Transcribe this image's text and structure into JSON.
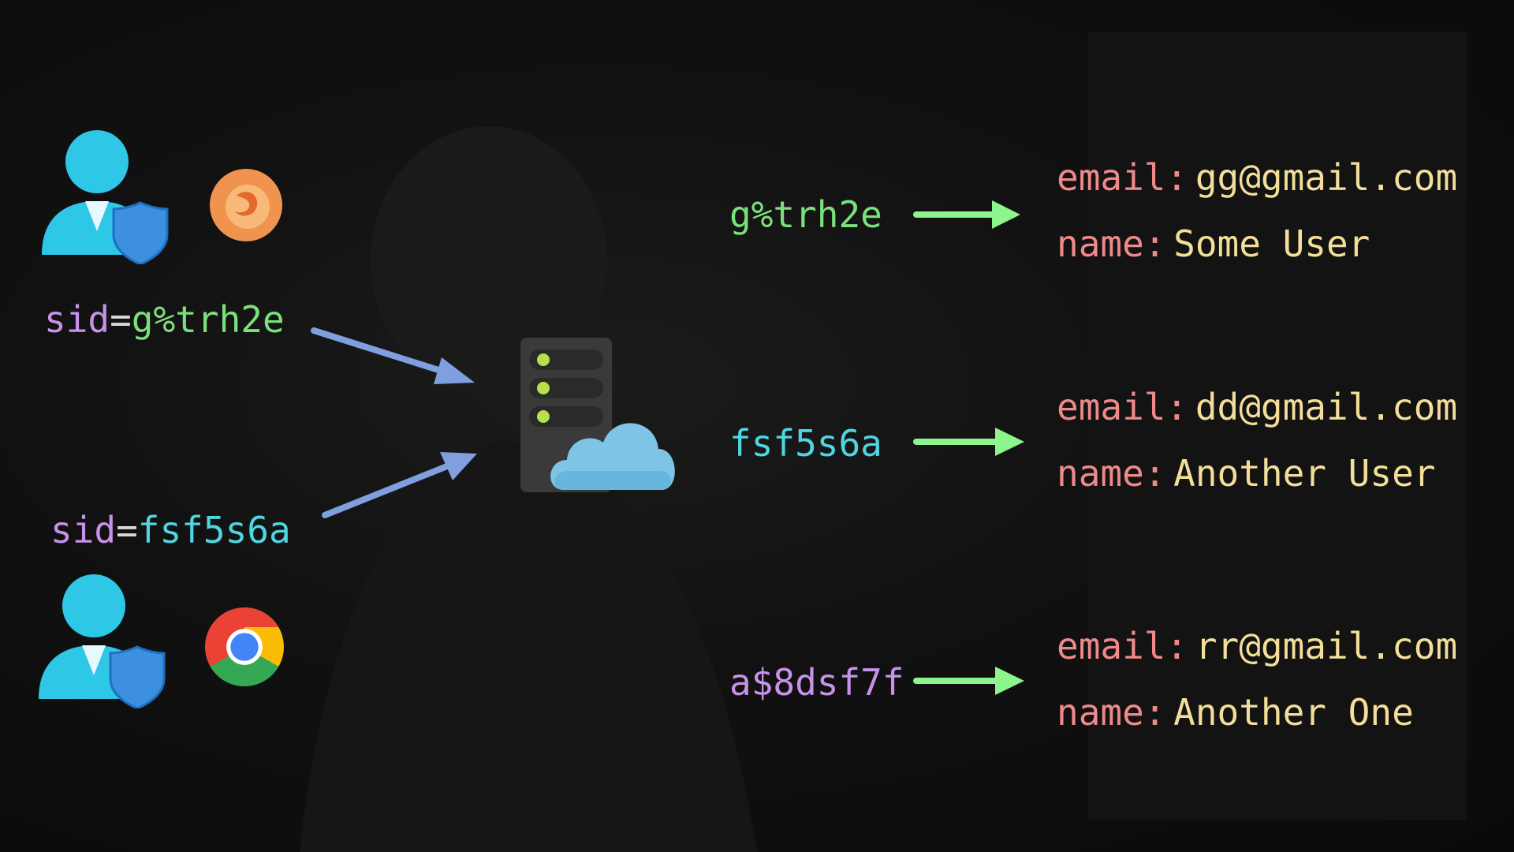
{
  "clients": [
    {
      "sid_key": "sid",
      "sid_eq": "=",
      "sid_value": "g%trh2e",
      "browser_icon": "firefox-icon",
      "user_icon": "user-shield-icon"
    },
    {
      "sid_key": "sid",
      "sid_eq": "=",
      "sid_value": "fsf5s6a",
      "browser_icon": "chrome-icon",
      "user_icon": "user-shield-icon"
    }
  ],
  "server_icon": "server-cloud-icon",
  "session_store": [
    {
      "key": "g%trh2e",
      "email_label": "email:",
      "email": "gg@gmail.com",
      "name_label": "name:",
      "name": "Some User"
    },
    {
      "key": "fsf5s6a",
      "email_label": "email:",
      "email": "dd@gmail.com",
      "name_label": "name:",
      "name": "Another User"
    },
    {
      "key": "a$8dsf7f",
      "email_label": "email:",
      "email": "rr@gmail.com",
      "name_label": "name:",
      "name": "Another One"
    }
  ],
  "colors": {
    "background": "#111111",
    "sid_key": "#c792ea",
    "value_green": "#7be07b",
    "value_cyan": "#4fd6e0",
    "value_purple": "#c792ea",
    "record_label": "#f08a8a",
    "record_value": "#f3df9a",
    "client_arrow": "#7f9fdf",
    "store_arrow": "#8cf58c",
    "user_icon": "#2ec7e6",
    "shield": "#3d8fe0"
  }
}
